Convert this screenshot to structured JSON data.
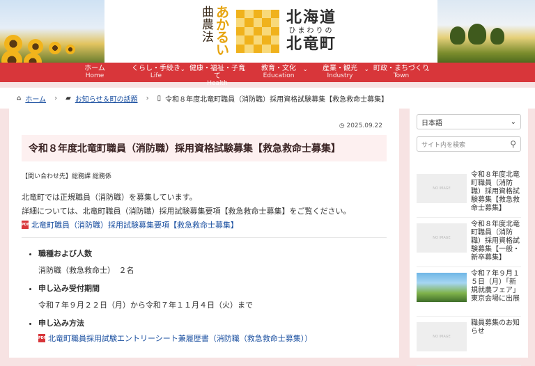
{
  "logo": {
    "vertical_cols": [
      [
        "曲",
        "農",
        "法"
      ],
      [
        "あ",
        "か",
        "る",
        "い"
      ]
    ],
    "line1": "北海道",
    "line2": "ひまわりの",
    "line3": "北竜町"
  },
  "nav": [
    {
      "jp": "ホーム",
      "en": "Home",
      "chevron": false
    },
    {
      "jp": "くらし・手続き",
      "en": "Life",
      "chevron": true
    },
    {
      "jp": "健康・福祉・子育て",
      "en": "Health",
      "chevron": true
    },
    {
      "jp": "教育・文化",
      "en": "Education",
      "chevron": true
    },
    {
      "jp": "産業・観光",
      "en": "Industry",
      "chevron": true
    },
    {
      "jp": "町政・まちづくり",
      "en": "Town",
      "chevron": true
    }
  ],
  "breadcrumb": {
    "home": "ホーム",
    "category": "お知らせ＆町の話題",
    "current": "令和８年度北竜町職員（消防職）採用資格試験募集【救急救命士募集】"
  },
  "article": {
    "date": "2025.09.22",
    "title": "令和８年度北竜町職員（消防職）採用資格試験募集【救急救命士募集】",
    "contact": "【問い合わせ先】総務課 総務係",
    "p1": "北竜町では正規職員（消防職）を募集しています。",
    "p2": "詳細については、北竜町職員（消防職）採用試験募集要項【救急救命士募集】をご覧ください。",
    "link1": "北竜町職員（消防職）採用試験募集要項【救急救命士募集】",
    "items": [
      {
        "label": "職種および人数",
        "value": "消防職（救急救命士）　２名"
      },
      {
        "label": "申し込み受付期間",
        "value": "令和７年９月２２日（月）から令和７年１１月４日（火）まで"
      },
      {
        "label": "申し込み方法",
        "link": "北竜町職員採用試験エントリーシート兼履歴書（消防職（救急救命士募集））"
      }
    ],
    "pdf_badge": "PDF"
  },
  "sidebar": {
    "language": "日本語",
    "search_placeholder": "サイト内を検索",
    "no_image": "NO IMAGE",
    "posts": [
      {
        "title": "令和８年度北竜町職員（消防職）採用資格試験募集【救急救命士募集】",
        "thumb": "none"
      },
      {
        "title": "令和８年度北竜町職員（消防職）採用資格試験募集【一般・新卒募集】",
        "thumb": "none"
      },
      {
        "title": "令和７年９月１５日（月）「新規就農フェア」東京会場に出展",
        "thumb": "photo"
      },
      {
        "title": "職員募集のお知らせ",
        "thumb": "none"
      }
    ]
  }
}
